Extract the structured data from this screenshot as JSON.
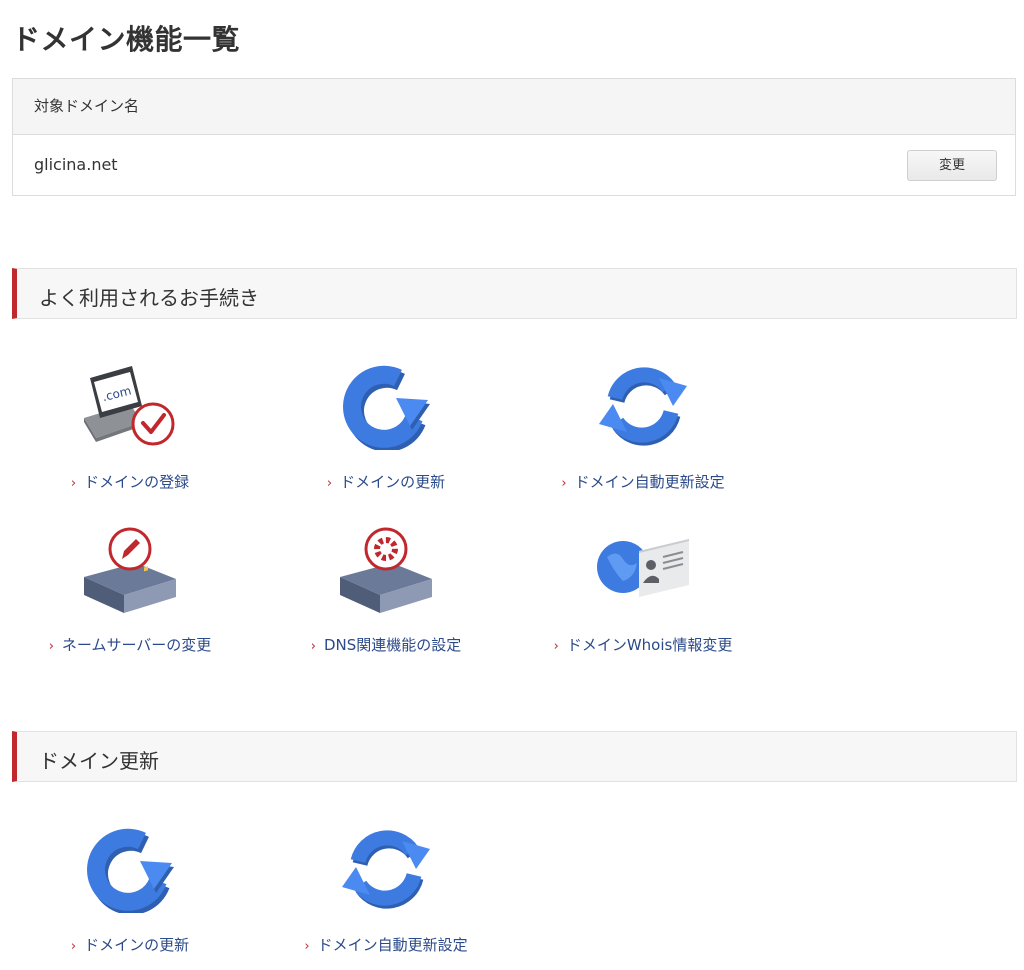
{
  "page": {
    "title": "ドメイン機能一覧"
  },
  "domain_box": {
    "header": "対象ドメイン名",
    "domain": "glicina.net",
    "change_button": "変更"
  },
  "sections": [
    {
      "title": "よく利用されるお手続き",
      "items": [
        {
          "label": "ドメインの登録",
          "icon": "laptop-dotcom-check-icon"
        },
        {
          "label": "ドメインの更新",
          "icon": "renew-arrow-icon"
        },
        {
          "label": "ドメイン自動更新設定",
          "icon": "auto-renew-cycle-icon"
        },
        {
          "label": "ネームサーバーの変更",
          "icon": "server-pencil-icon"
        },
        {
          "label": "DNS関連機能の設定",
          "icon": "server-gear-icon"
        },
        {
          "label": "ドメインWhois情報変更",
          "icon": "globe-id-card-icon"
        }
      ]
    },
    {
      "title": "ドメイン更新",
      "items": [
        {
          "label": "ドメインの更新",
          "icon": "renew-arrow-icon"
        },
        {
          "label": "ドメイン自動更新設定",
          "icon": "auto-renew-cycle-icon"
        }
      ]
    }
  ],
  "colors": {
    "accent": "#c0282d",
    "link": "#2b4a8a",
    "icon_blue": "#3d7be0",
    "server_slate": "#5a6a88"
  }
}
